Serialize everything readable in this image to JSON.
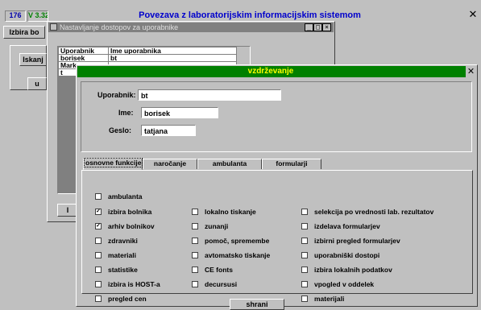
{
  "main": {
    "badge1": "176",
    "badge2": "V 3.32",
    "title": "Povezava z laboratorijskim informacijskim sistemom",
    "close_glyph": "✕",
    "left_button": "Izbira bo",
    "left_button_2": "Iskanj",
    "left_button_3": "u",
    "left_button_4": "I"
  },
  "access_window": {
    "title": "Nastavljanje dostopov za uporabnike",
    "columns": [
      "Uporabnik",
      "Ime uporabnika"
    ],
    "rows": [
      [
        "borisek",
        "bt"
      ],
      [
        "Mark",
        ""
      ],
      [
        "t",
        ""
      ]
    ]
  },
  "dialog": {
    "title": "vzdrževanje",
    "close_glyph": "✕",
    "fields": {
      "uporabnik_label": "Uporabnik:",
      "uporabnik_value": "bt",
      "ime_label": "Ime:",
      "ime_value": "borisek",
      "geslo_label": "Geslo:",
      "geslo_value": "tatjana"
    },
    "tabs": [
      "osnovne funkcije",
      "naročanje",
      "ambulanta",
      "formularji"
    ],
    "active_tab": 0,
    "checkboxes": {
      "col1": [
        {
          "label": "ambulanta",
          "checked": false
        },
        {
          "label": "izbira bolnika",
          "checked": true
        },
        {
          "label": "arhiv bolnikov",
          "checked": true
        },
        {
          "label": "zdravniki",
          "checked": false
        },
        {
          "label": "materiali",
          "checked": false
        },
        {
          "label": "statistike",
          "checked": false
        },
        {
          "label": "izbira is HOST-a",
          "checked": false
        },
        {
          "label": "pregled cen",
          "checked": false
        }
      ],
      "col2": [
        {
          "label": "lokalno tiskanje",
          "checked": false
        },
        {
          "label": "zunanji",
          "checked": false
        },
        {
          "label": "pomoč, spremembe",
          "checked": false
        },
        {
          "label": "avtomatsko tiskanje",
          "checked": false
        },
        {
          "label": "CE fonts",
          "checked": false
        },
        {
          "label": "decursusi",
          "checked": false
        }
      ],
      "col3": [
        {
          "label": "selekcija po vrednosti lab. rezultatov",
          "checked": false
        },
        {
          "label": "izdelava formularjev",
          "checked": false
        },
        {
          "label": "izbirni pregled formularjev",
          "checked": false
        },
        {
          "label": "uporabniški dostopi",
          "checked": false
        },
        {
          "label": "izbira lokalnih podatkov",
          "checked": false
        },
        {
          "label": "vpogled v oddelek",
          "checked": false
        },
        {
          "label": "materijali",
          "checked": false
        }
      ]
    },
    "save_button": "shrani"
  },
  "colors": {
    "title_bar": "#008000",
    "title_text": "#ffff00",
    "main_title": "#0000cc",
    "inactive_title": "#808080",
    "face": "#c0c0c0"
  }
}
